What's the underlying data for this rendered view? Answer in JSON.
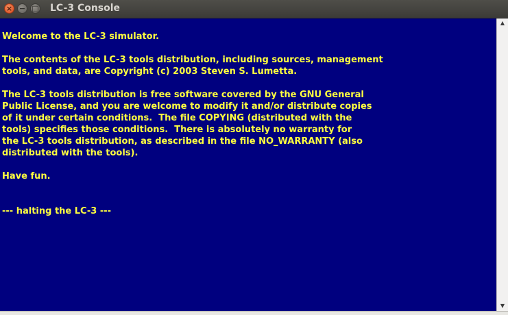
{
  "window": {
    "title": "LC-3 Console"
  },
  "titlebar_buttons": {
    "close_glyph": "×",
    "minimize_glyph": "−",
    "maximize_glyph": "□"
  },
  "console": {
    "lines": [
      "Welcome to the LC-3 simulator.",
      "",
      "The contents of the LC-3 tools distribution, including sources, management",
      "tools, and data, are Copyright (c) 2003 Steven S. Lumetta.",
      "",
      "The LC-3 tools distribution is free software covered by the GNU General",
      "Public License, and you are welcome to modify it and/or distribute copies",
      "of it under certain conditions.  The file COPYING (distributed with the",
      "tools) specifies those conditions.  There is absolutely no warranty for",
      "the LC-3 tools distribution, as described in the file NO_WARRANTY (also",
      "distributed with the tools).",
      "",
      "Have fun.",
      "",
      "",
      "--- halting the LC-3 ---"
    ]
  },
  "scrollbar": {
    "up_glyph": "▲",
    "down_glyph": "▼"
  },
  "colors": {
    "console_background": "#00007f",
    "console_text": "#ffff3f",
    "titlebar": "#3c3b37",
    "close_button": "#e05a28"
  }
}
